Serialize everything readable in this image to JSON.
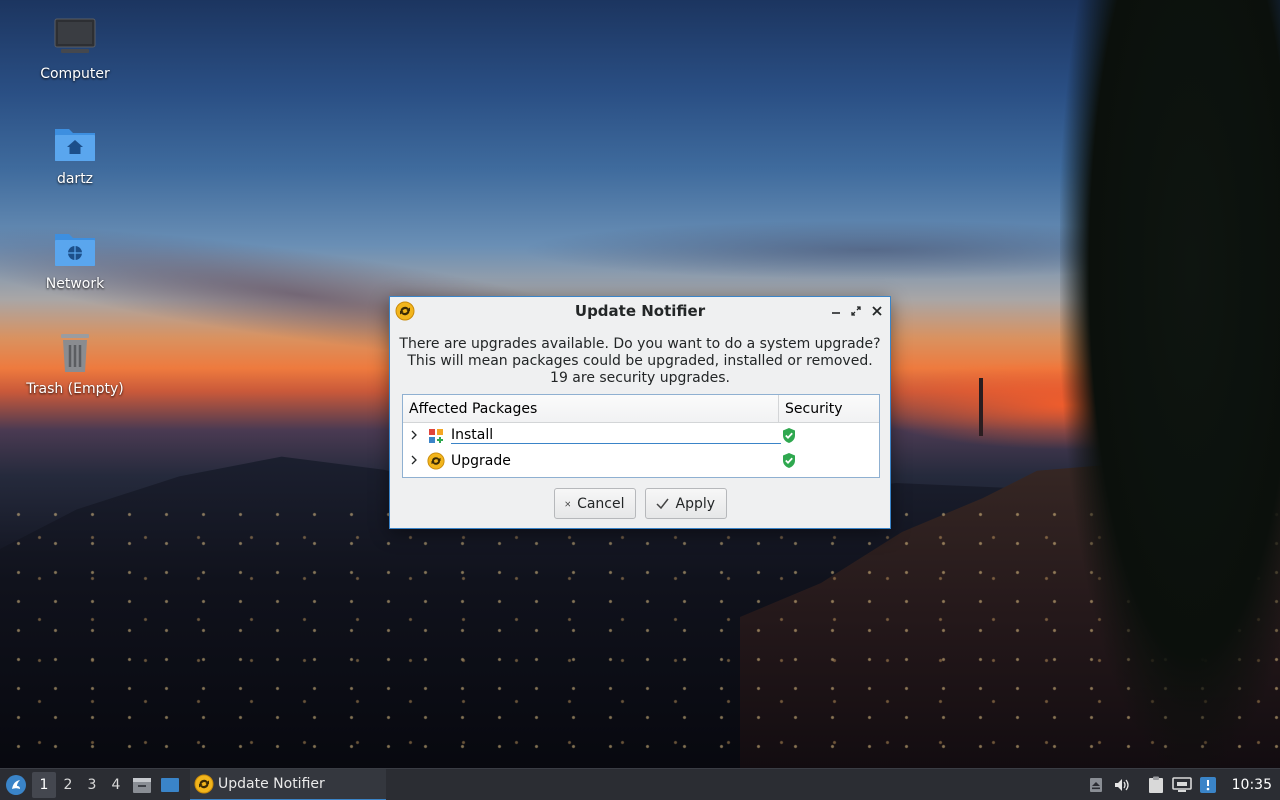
{
  "desktop": {
    "icons": [
      {
        "label": "Computer",
        "icon": "computer-icon"
      },
      {
        "label": "dartz",
        "icon": "home-folder-icon"
      },
      {
        "label": "Network",
        "icon": "network-folder-icon"
      },
      {
        "label": "Trash (Empty)",
        "icon": "trash-icon"
      }
    ]
  },
  "dialog": {
    "title": "Update Notifier",
    "message": {
      "line1": "There are upgrades available. Do you want to do a system upgrade?",
      "line2": "This will mean packages could be upgraded, installed or removed.",
      "line3": "19 are security upgrades."
    },
    "table": {
      "col_packages": "Affected Packages",
      "col_security": "Security",
      "rows": [
        {
          "label": "Install",
          "icon": "install-icon",
          "security": "shield-check-icon"
        },
        {
          "label": "Upgrade",
          "icon": "upgrade-icon",
          "security": "shield-check-icon"
        }
      ]
    },
    "buttons": {
      "cancel": "Cancel",
      "apply": "Apply"
    }
  },
  "taskbar": {
    "workspaces": [
      "1",
      "2",
      "3",
      "4"
    ],
    "active_workspace": "1",
    "task_label": "Update Notifier",
    "clock": "10:35"
  },
  "colors": {
    "accent": "#3a84c8",
    "shield_green": "#2fa84f",
    "taskbar_bg": "#2b2d33"
  }
}
